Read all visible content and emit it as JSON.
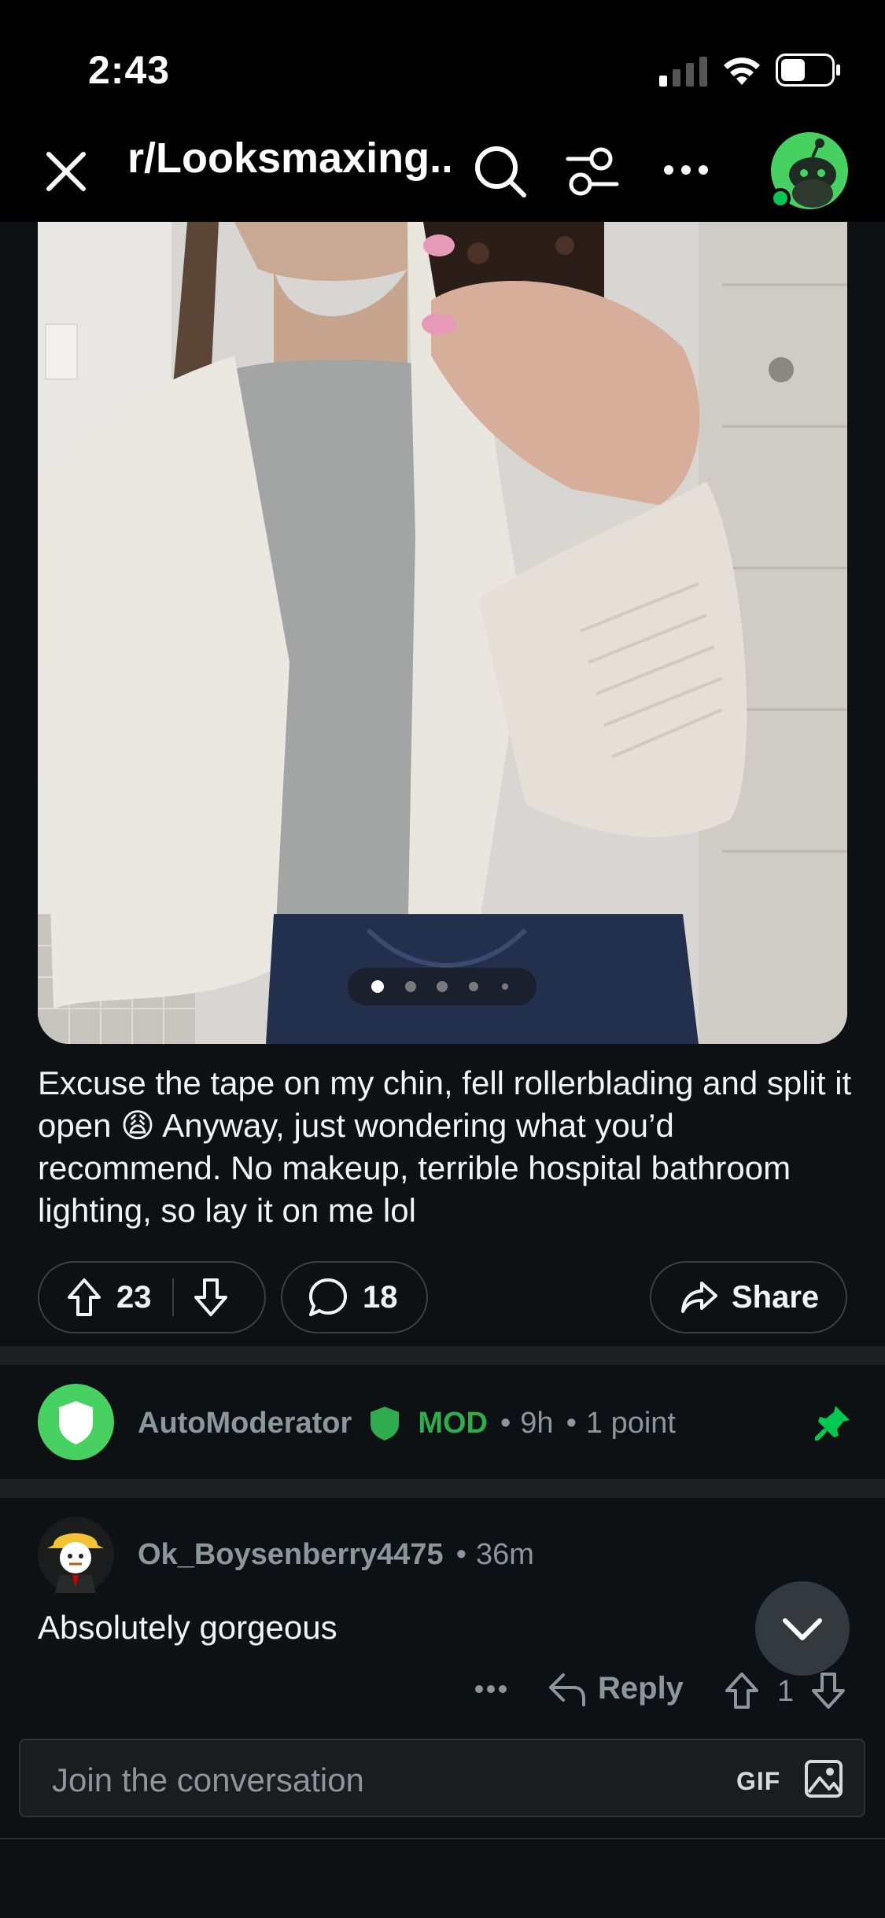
{
  "status_bar": {
    "time": "2:43"
  },
  "nav": {
    "title": "r/Looksmaxing...",
    "icons": [
      "close-icon",
      "search-icon",
      "filter-icon",
      "more-icon",
      "avatar"
    ]
  },
  "post": {
    "image_carousel": {
      "dot_count": 5,
      "active_index": 0
    },
    "body": "Excuse the tape on my chin, fell rollerblading and split it open 😩 Anyway, just wondering what you’d recommend. No makeup, terrible hospital bathroom lighting, so lay it on me lol",
    "votes": "23",
    "comments": "18",
    "share_label": "Share"
  },
  "comments": [
    {
      "author": "AutoModerator",
      "badge": "MOD",
      "time": "9h",
      "points": "1 point",
      "pinned": true
    },
    {
      "author": "Ok_Boysenberry4475",
      "time": "36m",
      "text": "Absolutely gorgeous",
      "reply_label": "Reply",
      "votes": "1"
    }
  ],
  "composer": {
    "placeholder": "Join the conversation",
    "gif_label": "GIF"
  },
  "colors": {
    "background": "#0e1113",
    "mod_green": "#2eac4e",
    "automod_green": "#46d160",
    "pin_green": "#00c853"
  }
}
